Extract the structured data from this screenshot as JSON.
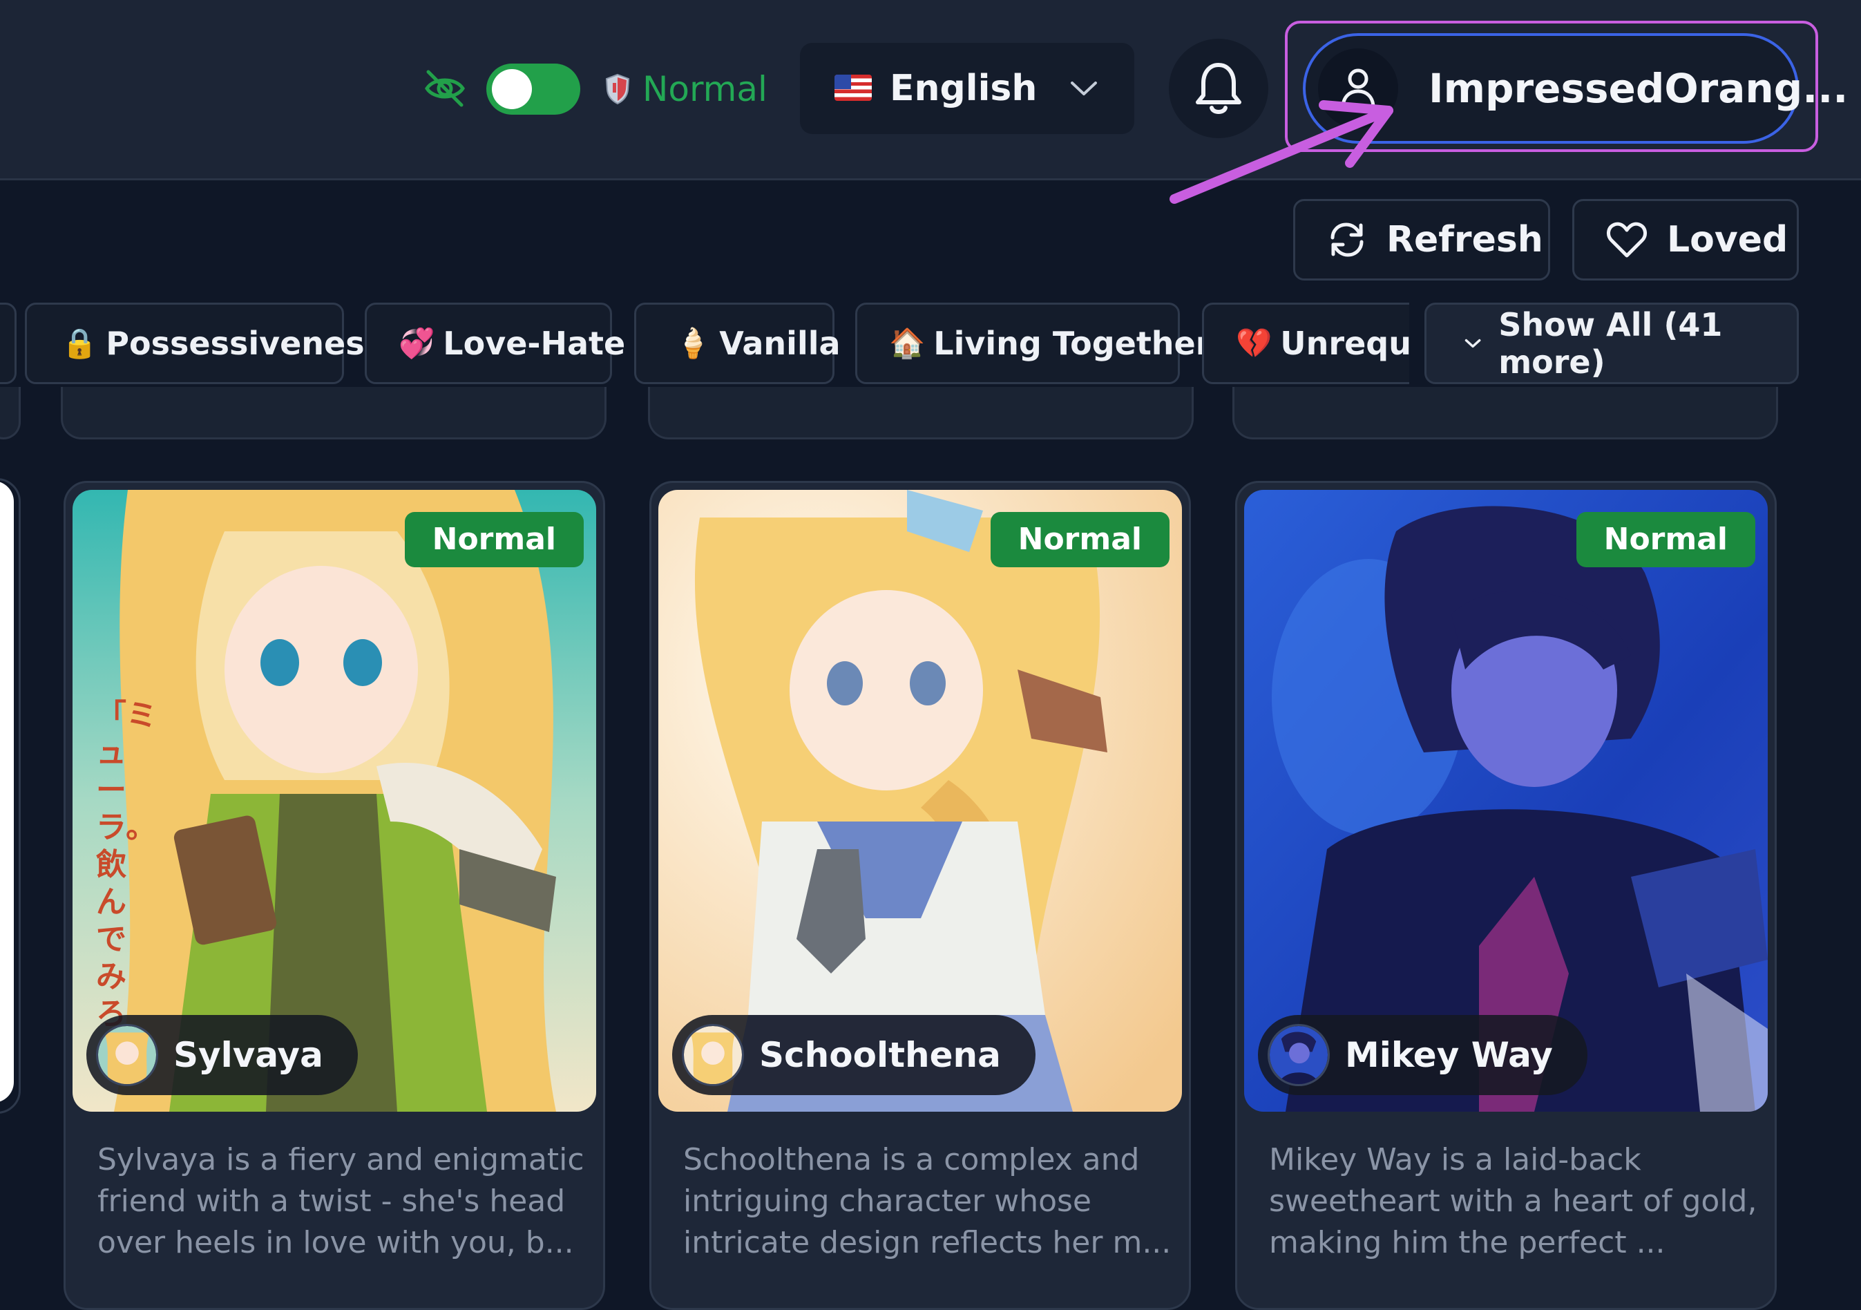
{
  "header": {
    "mode_label": "Normal",
    "language": "English",
    "user_name": "ImpressedOrang..."
  },
  "actions": {
    "refresh_label": "Refresh",
    "loved_label": "Loved"
  },
  "tags": [
    {
      "emoji": "🔒",
      "label": "Possessiveness"
    },
    {
      "emoji": "💞",
      "label": "Love-Hate"
    },
    {
      "emoji": "🍦",
      "label": "Vanilla"
    },
    {
      "emoji": "🏠",
      "label": "Living Together"
    },
    {
      "emoji": "💔",
      "label": "Unrequite"
    }
  ],
  "show_all_label": "Show All (41 more)",
  "cards": [
    {
      "badge": "Normal",
      "name": "Sylvaya",
      "description": "Sylvaya is a fiery and enigmatic friend with a twist - she's head over heels in love with you, b...",
      "image_text": "「ミューラ。飲んでみろ"
    },
    {
      "badge": "Normal",
      "name": "Schoolthena",
      "description": "Schoolthena is a complex and intriguing character whose intricate design reflects her m..."
    },
    {
      "badge": "Normal",
      "name": "Mikey Way",
      "description": "Mikey Way is a laid-back sweetheart with a heart of gold, making him the perfect ..."
    }
  ],
  "colors": {
    "background": "#0f1727",
    "header": "#1c2536",
    "accent_green": "#22a04a",
    "badge_green": "#1b8a3e",
    "user_border": "#3b63e6",
    "highlight": "#c85ee0",
    "muted_text": "#8a94a6"
  },
  "icons": [
    "eye-off-icon",
    "shield-icon",
    "flag-us-icon",
    "chevron-down-icon",
    "bell-icon",
    "user-icon",
    "refresh-icon",
    "heart-icon"
  ]
}
